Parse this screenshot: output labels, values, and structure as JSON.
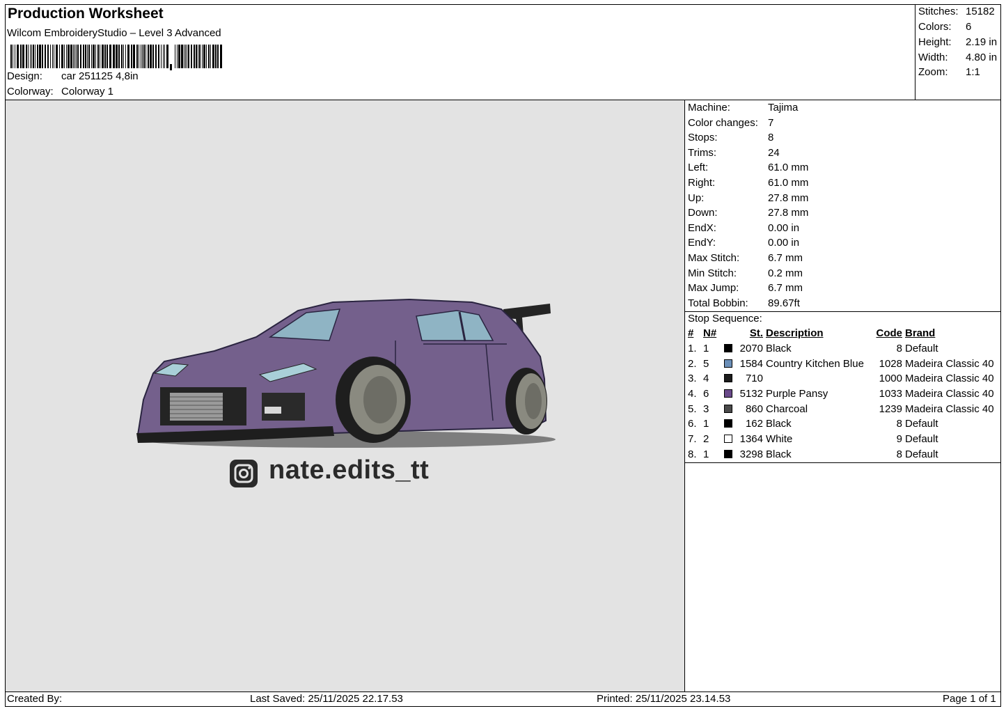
{
  "header": {
    "title": "Production Worksheet",
    "subtitle": "Wilcom EmbroideryStudio – Level 3 Advanced",
    "design_label": "Design:",
    "design_value": "car 251125 4,8in",
    "colorway_label": "Colorway:",
    "colorway_value": "Colorway 1"
  },
  "summary": [
    {
      "label": "Stitches:",
      "value": "15182"
    },
    {
      "label": "Colors:",
      "value": "6"
    },
    {
      "label": "Height:",
      "value": "2.19 in"
    },
    {
      "label": "Width:",
      "value": "4.80 in"
    },
    {
      "label": "Zoom:",
      "value": "1:1"
    }
  ],
  "design": {
    "handle_text": "nate.edits_tt",
    "icon": "instagram-icon",
    "colors": {
      "body": "#74608c",
      "glass": "#8fb4c4",
      "dark": "#1e1e1e",
      "rim": "#8a8a80",
      "background": "#e3e3e3"
    }
  },
  "specs": [
    {
      "label": "Machine:",
      "value": "Tajima"
    },
    {
      "label": "Color changes:",
      "value": "7"
    },
    {
      "label": "Stops:",
      "value": "8"
    },
    {
      "label": "Trims:",
      "value": "24"
    },
    {
      "label": "Left:",
      "value": "61.0 mm"
    },
    {
      "label": "Right:",
      "value": "61.0 mm"
    },
    {
      "label": "Up:",
      "value": "27.8 mm"
    },
    {
      "label": "Down:",
      "value": "27.8 mm"
    },
    {
      "label": "EndX:",
      "value": "0.00 in"
    },
    {
      "label": "EndY:",
      "value": "0.00 in"
    },
    {
      "label": "Max Stitch:",
      "value": "6.7 mm"
    },
    {
      "label": "Min Stitch:",
      "value": "0.2 mm"
    },
    {
      "label": "Max Jump:",
      "value": "6.7 mm"
    },
    {
      "label": "Total Bobbin:",
      "value": "89.67ft"
    }
  ],
  "stop_sequence": {
    "title": "Stop Sequence:",
    "headers": {
      "num": "#",
      "n": "N#",
      "st": "St.",
      "desc": "Description",
      "code": "Code",
      "brand": "Brand"
    },
    "rows": [
      {
        "num": "1.",
        "n": "1",
        "color": "#000000",
        "st": "2070",
        "desc": "Black",
        "code": "8",
        "brand": "Default"
      },
      {
        "num": "2.",
        "n": "5",
        "color": "#6b8fb8",
        "st": "1584",
        "desc": "Country Kitchen Blue",
        "code": "1028",
        "brand": "Madeira Classic 40"
      },
      {
        "num": "3.",
        "n": "4",
        "color": "#1c1c1c",
        "st": "710",
        "desc": "",
        "code": "1000",
        "brand": "Madeira Classic 40"
      },
      {
        "num": "4.",
        "n": "6",
        "color": "#6a4a8a",
        "st": "5132",
        "desc": "Purple Pansy",
        "code": "1033",
        "brand": "Madeira Classic 40"
      },
      {
        "num": "5.",
        "n": "3",
        "color": "#4a4a4a",
        "st": "860",
        "desc": "Charcoal",
        "code": "1239",
        "brand": "Madeira Classic 40"
      },
      {
        "num": "6.",
        "n": "1",
        "color": "#000000",
        "st": "162",
        "desc": "Black",
        "code": "8",
        "brand": "Default"
      },
      {
        "num": "7.",
        "n": "2",
        "color": "#ffffff",
        "st": "1364",
        "desc": "White",
        "code": "9",
        "brand": "Default"
      },
      {
        "num": "8.",
        "n": "1",
        "color": "#000000",
        "st": "3298",
        "desc": "Black",
        "code": "8",
        "brand": "Default"
      }
    ]
  },
  "footer": {
    "created_by": "Created By:",
    "last_saved": "Last Saved: 25/11/2025 22.17.53",
    "printed": "Printed: 25/11/2025 23.14.53",
    "page": "Page 1 of 1"
  }
}
